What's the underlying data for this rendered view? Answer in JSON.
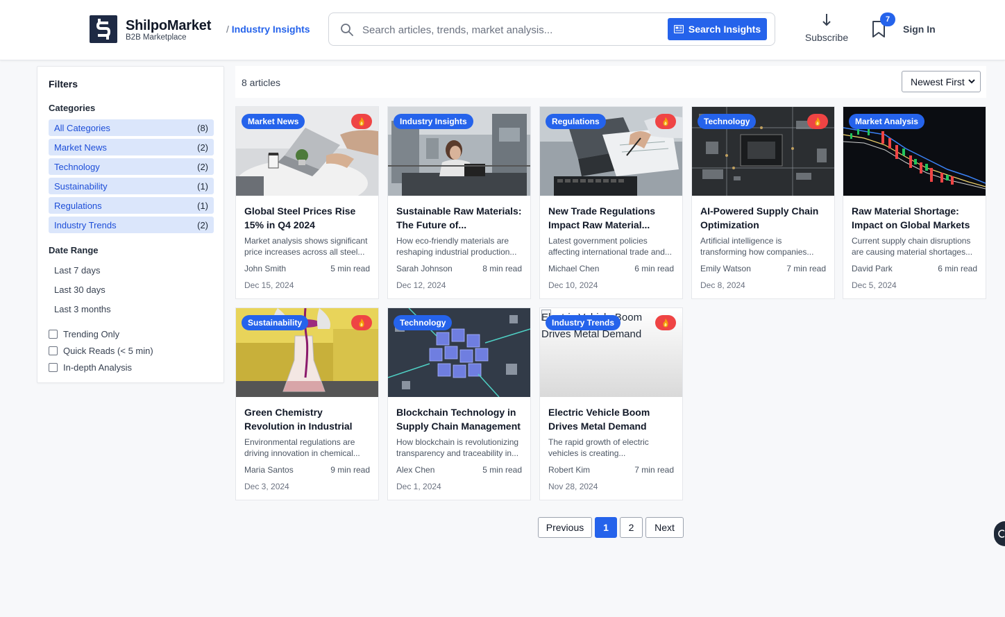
{
  "header": {
    "brand_name": "ShilpoMarket",
    "brand_sub": "B2B Marketplace",
    "breadcrumb_sep": "/ ",
    "breadcrumb_current": "Industry Insights",
    "search_placeholder": "Search articles, trends, market analysis...",
    "search_button": "Search Insights",
    "subscribe_label": "Subscribe",
    "bookmark_count": "7",
    "signin_label": "Sign In"
  },
  "sidebar": {
    "title": "Filters",
    "categories_heading": "Categories",
    "categories": [
      {
        "label": "All Categories",
        "count": "(8)"
      },
      {
        "label": "Market News",
        "count": "(2)"
      },
      {
        "label": "Technology",
        "count": "(2)"
      },
      {
        "label": "Sustainability",
        "count": "(1)"
      },
      {
        "label": "Regulations",
        "count": "(1)"
      },
      {
        "label": "Industry Trends",
        "count": "(2)"
      }
    ],
    "date_heading": "Date Range",
    "date_ranges": [
      "Last 7 days",
      "Last 30 days",
      "Last 3 months"
    ],
    "checkboxes": [
      "Trending Only",
      "Quick Reads (< 5 min)",
      "In-depth Analysis"
    ]
  },
  "toolbar": {
    "article_count": "8 articles",
    "sort_value": "Newest First"
  },
  "articles": [
    {
      "tag": "Market News",
      "title": "Global Steel Prices Rise 15% in Q4 2024",
      "desc": "Market analysis shows significant price increases across all steel...",
      "author": "John Smith",
      "read": "5 min read",
      "date": "Dec 15, 2024"
    },
    {
      "tag": "Industry Insights",
      "title": "Sustainable Raw Materials: The Future of...",
      "desc": "How eco-friendly materials are reshaping industrial production...",
      "author": "Sarah Johnson",
      "read": "8 min read",
      "date": "Dec 12, 2024"
    },
    {
      "tag": "Regulations",
      "title": "New Trade Regulations Impact Raw Material...",
      "desc": "Latest government policies affecting international trade and...",
      "author": "Michael Chen",
      "read": "6 min read",
      "date": "Dec 10, 2024"
    },
    {
      "tag": "Technology",
      "title": "AI-Powered Supply Chain Optimization",
      "desc": "Artificial intelligence is transforming how companies...",
      "author": "Emily Watson",
      "read": "7 min read",
      "date": "Dec 8, 2024"
    },
    {
      "tag": "Market Analysis",
      "title": "Raw Material Shortage: Impact on Global Markets",
      "desc": "Current supply chain disruptions are causing material shortages...",
      "author": "David Park",
      "read": "6 min read",
      "date": "Dec 5, 2024"
    },
    {
      "tag": "Sustainability",
      "title": "Green Chemistry Revolution in Industrial Production",
      "desc": "Environmental regulations are driving innovation in chemical...",
      "author": "Maria Santos",
      "read": "9 min read",
      "date": "Dec 3, 2024"
    },
    {
      "tag": "Technology",
      "title": "Blockchain Technology in Supply Chain Management",
      "desc": "How blockchain is revolutionizing transparency and traceability in...",
      "author": "Alex Chen",
      "read": "5 min read",
      "date": "Dec 1, 2024"
    },
    {
      "tag": "Industry Trends",
      "title": "Electric Vehicle Boom Drives Metal Demand",
      "desc": "The rapid growth of electric vehicles is creating...",
      "author": "Robert Kim",
      "read": "7 min read",
      "date": "Nov 28, 2024",
      "image_alt": "Electric Vehicle Boom Drives Metal Demand"
    }
  ],
  "pagination": {
    "previous": "Previous",
    "pages": [
      "1",
      "2"
    ],
    "next": "Next"
  },
  "colors": {
    "accent": "#2563eb",
    "hot": "#ef4444",
    "category_bg": "#dbe6fb"
  }
}
